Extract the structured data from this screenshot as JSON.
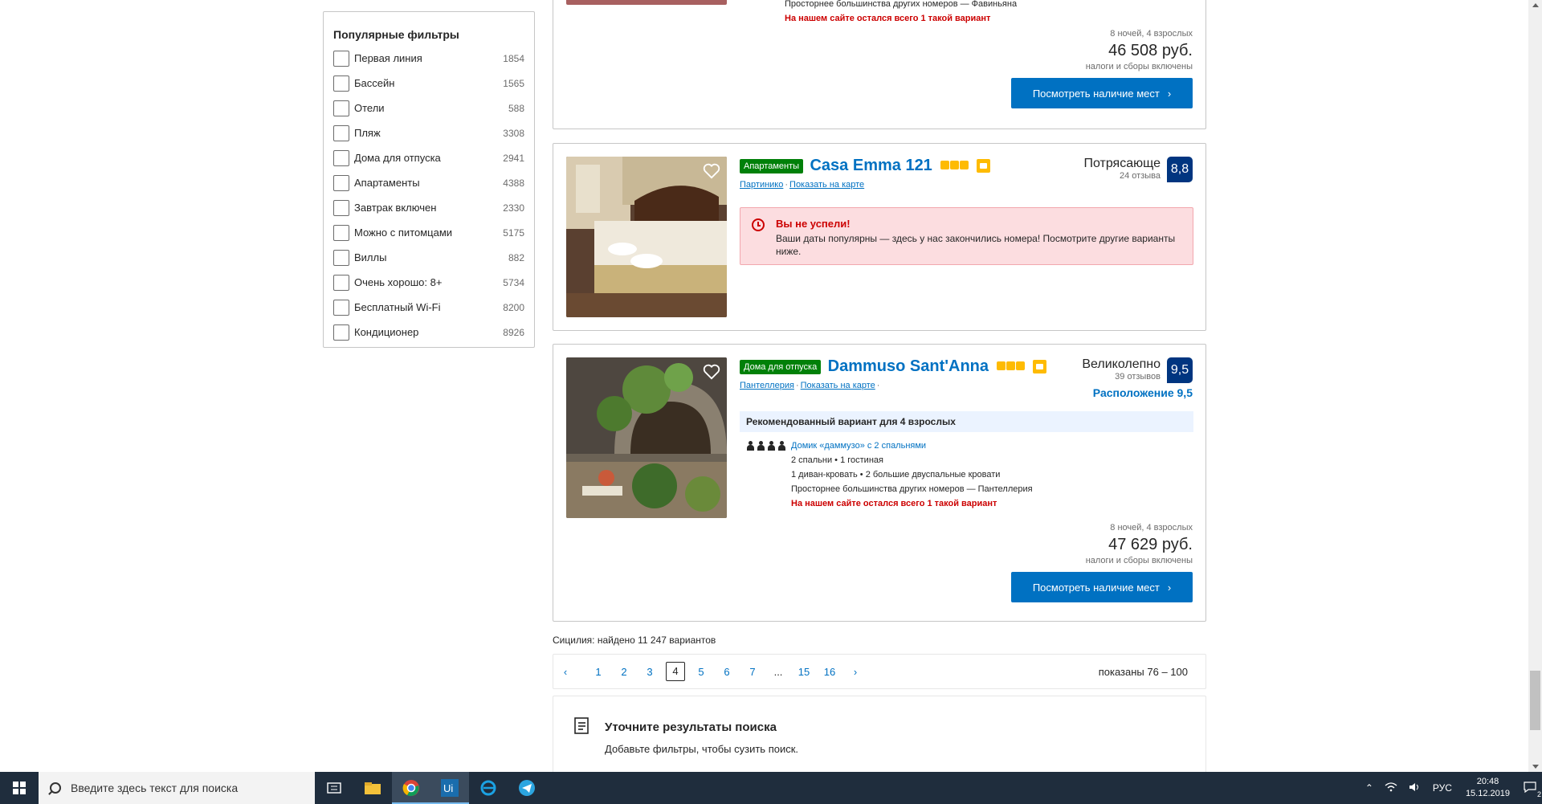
{
  "filters": {
    "title": "Популярные фильтры",
    "items": [
      {
        "label": "Первая линия",
        "count": "1854"
      },
      {
        "label": "Бассейн",
        "count": "1565"
      },
      {
        "label": "Отели",
        "count": "588"
      },
      {
        "label": "Пляж",
        "count": "3308"
      },
      {
        "label": "Дома для отпуска",
        "count": "2941"
      },
      {
        "label": "Апартаменты",
        "count": "4388"
      },
      {
        "label": "Завтрак включен",
        "count": "2330"
      },
      {
        "label": "Можно с питомцами",
        "count": "5175"
      },
      {
        "label": "Виллы",
        "count": "882"
      },
      {
        "label": "Очень хорошо: 8+",
        "count": "5734"
      },
      {
        "label": "Бесплатный Wi-Fi",
        "count": "8200"
      },
      {
        "label": "Кондиционер",
        "count": "8926"
      }
    ]
  },
  "card1": {
    "room_line": "Просторнее большинства других номеров — Фавиньяна",
    "scarcity": "На нашем сайте остался всего 1 такой вариант",
    "price_meta": "8 ночей, 4 взрослых",
    "price": "46 508 руб.",
    "price_note": "налоги и сборы включены",
    "button": "Посмотреть наличие мест"
  },
  "card2": {
    "type": "Апартаменты",
    "name": "Casa Emma 121",
    "stars": 3,
    "location": "Партинико",
    "map_link": "Показать на карте",
    "score_word": "Потрясающе",
    "reviews": "24 отзыва",
    "score": "8,8",
    "alert_title": "Вы не успели!",
    "alert_body": "Ваши даты популярны — здесь у нас закончились номера! Посмотрите другие варианты ниже."
  },
  "card3": {
    "type": "Дома для отпуска",
    "name": "Dammuso Sant'Anna",
    "stars": 3,
    "location": "Пантеллерия",
    "map_link": "Показать на карте",
    "score_word": "Великолепно",
    "reviews": "39 отзывов",
    "score": "9,5",
    "location_score": "Расположение 9,5",
    "recommended": "Рекомендованный вариант для 4 взрослых",
    "room_name": "Домик «даммузо» с 2 спальнями",
    "room_l1": "2 спальни • 1 гостиная",
    "room_l2": "1 диван-кровать • 2 большие двуспальные кровати",
    "room_l3": "Просторнее большинства других номеров — Пантеллерия",
    "scarcity": "На нашем сайте остался всего 1 такой вариант",
    "price_meta": "8 ночей, 4 взрослых",
    "price": "47 629 руб.",
    "price_note": "налоги и сборы включены",
    "button": "Посмотреть наличие мест"
  },
  "results_count": "Сицилия: найдено 11 247 вариантов",
  "pagination": {
    "prev": "‹",
    "pages": [
      "1",
      "2",
      "3",
      "4",
      "5",
      "6",
      "7",
      "...",
      "15",
      "16"
    ],
    "current": "4",
    "next": "›",
    "shown": "показаны 76 – 100"
  },
  "refine": {
    "title": "Уточните результаты поиска",
    "subtitle": "Добавьте фильтры, чтобы сузить поиск."
  },
  "taskbar": {
    "search_placeholder": "Введите здесь текст для поиска",
    "lang": "РУС",
    "time": "20:48",
    "date": "15.12.2019",
    "notification_count": "2"
  },
  "colors": {
    "link": "#0071c2",
    "score": "#003580",
    "badge_green": "#008009",
    "star": "#febb02",
    "alert_red": "#cc0000"
  }
}
